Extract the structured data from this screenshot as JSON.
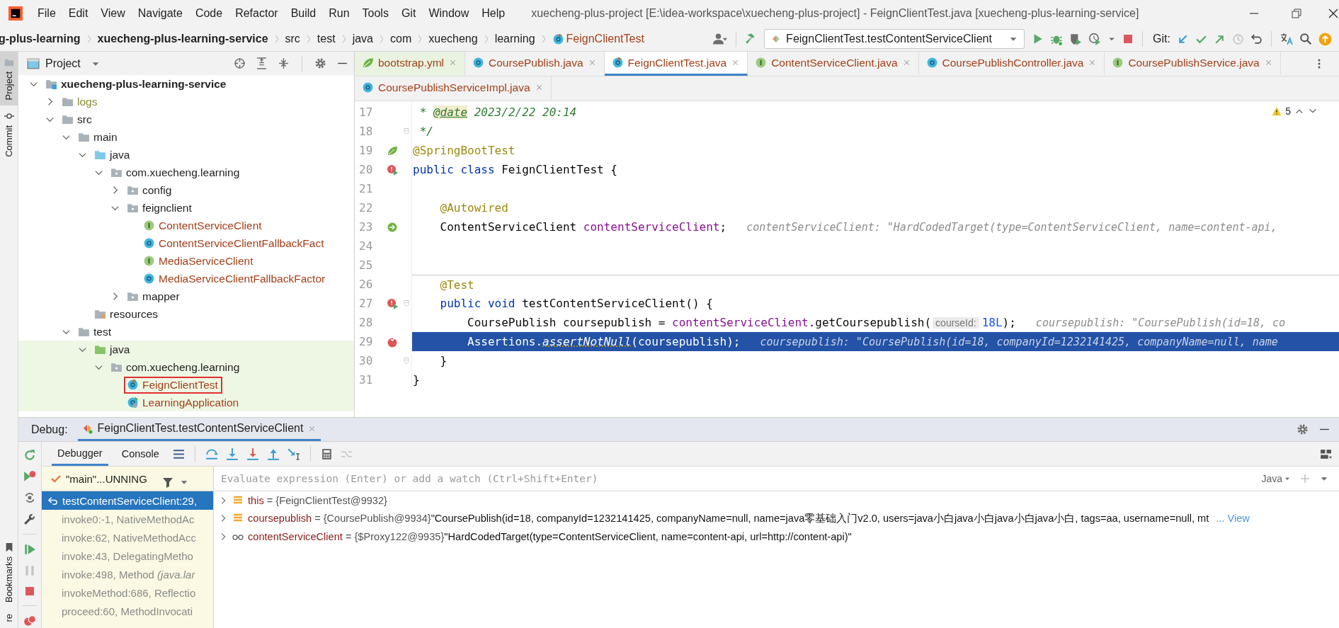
{
  "window": {
    "title": "xuecheng-plus-project [E:\\idea-workspace\\xuecheng-plus-project] - FeignClientTest.java [xuecheng-plus-learning-service]"
  },
  "menu": [
    "File",
    "Edit",
    "View",
    "Navigate",
    "Code",
    "Refactor",
    "Build",
    "Run",
    "Tools",
    "Git",
    "Window",
    "Help"
  ],
  "breadcrumb": [
    {
      "label": "g-plus-learning",
      "kind": "module"
    },
    {
      "label": "xuecheng-plus-learning-service",
      "kind": "module"
    },
    {
      "label": "src",
      "kind": "folder"
    },
    {
      "label": "test",
      "kind": "folder"
    },
    {
      "label": "java",
      "kind": "folder"
    },
    {
      "label": "com",
      "kind": "folder"
    },
    {
      "label": "xuecheng",
      "kind": "folder"
    },
    {
      "label": "learning",
      "kind": "folder"
    },
    {
      "label": "FeignClientTest",
      "kind": "test-class"
    }
  ],
  "run_config": {
    "label": "FeignClientTest.testContentServiceClient"
  },
  "git_label": "Git:",
  "tool_stripe": [
    {
      "label": "Project",
      "kind": "project",
      "selected": true
    },
    {
      "label": "Commit",
      "kind": "commit",
      "selected": false
    }
  ],
  "tool_stripe_bottom": [
    {
      "label": "Bookmarks",
      "kind": "bookmarks",
      "selected": false
    },
    {
      "label": "re",
      "selected": false
    }
  ],
  "project_panel": {
    "title": "Project"
  },
  "tree": [
    {
      "label": "xuecheng-plus-learning-service",
      "kind": "module",
      "expanded": true,
      "children": [
        {
          "label": "logs",
          "kind": "folder",
          "color": "#8a8a2e",
          "expanded": false
        },
        {
          "label": "src",
          "kind": "folder",
          "expanded": true,
          "children": [
            {
              "label": "main",
              "kind": "folder",
              "expanded": true,
              "children": [
                {
                  "label": "java",
                  "kind": "source-folder",
                  "expanded": true,
                  "children": [
                    {
                      "label": "com.xuecheng.learning",
                      "kind": "package",
                      "expanded": true,
                      "children": [
                        {
                          "label": "config",
                          "kind": "package",
                          "expanded": false
                        },
                        {
                          "label": "feignclient",
                          "kind": "package",
                          "expanded": true,
                          "children": [
                            {
                              "label": "ContentServiceClient",
                              "kind": "interface",
                              "color": "#a3401a"
                            },
                            {
                              "label": "ContentServiceClientFallbackFact",
                              "kind": "class",
                              "color": "#a3401a"
                            },
                            {
                              "label": "MediaServiceClient",
                              "kind": "interface",
                              "color": "#a3401a"
                            },
                            {
                              "label": "MediaServiceClientFallbackFactor",
                              "kind": "class",
                              "color": "#a3401a"
                            }
                          ]
                        },
                        {
                          "label": "mapper",
                          "kind": "package",
                          "expanded": false
                        }
                      ]
                    }
                  ]
                },
                {
                  "label": "resources",
                  "kind": "resources"
                }
              ]
            },
            {
              "label": "test",
              "kind": "folder",
              "expanded": true,
              "children": [
                {
                  "label": "java",
                  "kind": "test-folder",
                  "expanded": true,
                  "children": [
                    {
                      "label": "com.xuecheng.learning",
                      "kind": "package",
                      "expanded": true,
                      "children": [
                        {
                          "label": "FeignClientTest",
                          "kind": "test-class",
                          "color": "#a3401a",
                          "boxed": true
                        },
                        {
                          "label": "LearningApplication",
                          "kind": "app-class",
                          "color": "#a3401a"
                        }
                      ]
                    }
                  ]
                }
              ]
            }
          ]
        }
      ]
    }
  ],
  "tab_rows": [
    {
      "tabs": [
        {
          "label": "bootstrap.yml",
          "kind": "yaml",
          "selected": false
        },
        {
          "label": "CoursePublish.java",
          "kind": "class",
          "selected": false
        },
        {
          "label": "FeignClientTest.java",
          "kind": "test-class",
          "selected": true
        },
        {
          "label": "ContentServiceClient.java",
          "kind": "interface",
          "selected": false
        },
        {
          "label": "CoursePublishController.java",
          "kind": "class",
          "selected": false
        },
        {
          "label": "CoursePublishService.java",
          "kind": "interface",
          "selected": false
        }
      ]
    },
    {
      "tabs": [
        {
          "label": "CoursePublishServiceImpl.java",
          "kind": "class",
          "selected": false
        }
      ]
    }
  ],
  "editor": {
    "warnings": "5",
    "lines": [
      {
        "number": "17",
        "fold": false,
        "separator": false,
        "current": false,
        "parts": [
          {
            "kind": "code",
            "tokens": [
              {
                "text": " * ",
                "kind": "comment"
              },
              {
                "text": "@date",
                "kind": "doc-tag"
              },
              {
                "text": " 2023/2/22 20:14",
                "kind": "comment"
              }
            ]
          }
        ]
      },
      {
        "number": "18",
        "fold": true,
        "separator": false,
        "current": false,
        "parts": [
          {
            "kind": "code",
            "tokens": [
              {
                "text": " */",
                "kind": "comment"
              }
            ]
          }
        ]
      },
      {
        "number": "19",
        "gutter": {
          "kind": "spring"
        },
        "fold": false,
        "separator": false,
        "current": false,
        "parts": [
          {
            "kind": "code",
            "tokens": [
              {
                "text": "@SpringBootTest",
                "kind": "annotation"
              }
            ]
          }
        ]
      },
      {
        "number": "20",
        "gutter": {
          "kind": "run-breakpoint"
        },
        "fold": false,
        "separator": false,
        "current": false,
        "parts": [
          {
            "kind": "code",
            "tokens": [
              {
                "text": "public class ",
                "kind": "keyword"
              },
              {
                "text": "FeignClientTest {",
                "kind": "plain"
              }
            ]
          }
        ]
      },
      {
        "number": "21",
        "fold": false,
        "separator": false,
        "current": false
      },
      {
        "number": "22",
        "fold": false,
        "separator": false,
        "current": false,
        "parts": [
          {
            "kind": "code",
            "tokens": [
              {
                "text": "    @Autowired",
                "kind": "annotation"
              }
            ]
          }
        ]
      },
      {
        "number": "23",
        "gutter": {
          "kind": "bean"
        },
        "fold": false,
        "separator": false,
        "current": false,
        "parts": [
          {
            "kind": "code",
            "tokens": [
              {
                "text": "    ContentServiceClient ",
                "kind": "plain"
              },
              {
                "text": "contentServiceClient",
                "kind": "field"
              },
              {
                "text": ";",
                "kind": "plain"
              }
            ]
          },
          {
            "kind": "value",
            "text": "contentServiceClient: \"HardCodedTarget(type=ContentServiceClient, name=content-api,"
          }
        ]
      },
      {
        "number": "24",
        "fold": false,
        "separator": false,
        "current": false
      },
      {
        "number": "25",
        "fold": false,
        "separator": false,
        "current": false
      },
      {
        "number": "26",
        "fold": false,
        "separator": true,
        "current": false,
        "parts": [
          {
            "kind": "code",
            "tokens": [
              {
                "text": "    @Test",
                "kind": "annotation"
              }
            ]
          }
        ]
      },
      {
        "number": "27",
        "gutter": {
          "kind": "run-breakpoint"
        },
        "fold": true,
        "separator": false,
        "current": false,
        "parts": [
          {
            "kind": "code",
            "tokens": [
              {
                "text": "    public void ",
                "kind": "keyword"
              },
              {
                "text": "testContentServiceClient() {",
                "kind": "plain"
              }
            ]
          }
        ]
      },
      {
        "number": "28",
        "fold": false,
        "separator": false,
        "current": false,
        "parts": [
          {
            "kind": "code",
            "tokens": [
              {
                "text": "        CoursePublish coursepublish = ",
                "kind": "plain"
              },
              {
                "text": "contentServiceClient",
                "kind": "field"
              },
              {
                "text": ".getCoursepublish(",
                "kind": "plain"
              }
            ]
          },
          {
            "kind": "hint",
            "text": "courseId:"
          },
          {
            "kind": "code",
            "tokens": [
              {
                "text": "18L",
                "kind": "number"
              },
              {
                "text": ");",
                "kind": "plain"
              }
            ]
          },
          {
            "kind": "value",
            "text": "coursepublish: \"CoursePublish(id=18, co"
          }
        ]
      },
      {
        "number": "29",
        "gutter": {
          "kind": "breakpoint-check"
        },
        "fold": false,
        "separator": false,
        "current": true,
        "parts": [
          {
            "kind": "code",
            "tokens": [
              {
                "text": "        Assertions.",
                "kind": "plain"
              },
              {
                "text": "assertNotNull",
                "kind": "static-method"
              },
              {
                "text": "(coursepublish);",
                "kind": "plain"
              }
            ]
          },
          {
            "kind": "value",
            "text": "coursepublish: \"CoursePublish(id=18, companyId=1232141425, companyName=null, name"
          }
        ]
      },
      {
        "number": "30",
        "fold": true,
        "separator": false,
        "current": false,
        "parts": [
          {
            "kind": "code",
            "tokens": [
              {
                "text": "    }",
                "kind": "plain"
              }
            ]
          }
        ]
      },
      {
        "number": "31",
        "fold": false,
        "separator": false,
        "current": false,
        "parts": [
          {
            "kind": "code",
            "tokens": [
              {
                "text": "}",
                "kind": "plain"
              }
            ]
          }
        ]
      }
    ]
  },
  "debug": {
    "label": "Debug:",
    "session": "FeignClientTest.testContentServiceClient",
    "subtabs": [
      {
        "label": "Debugger",
        "selected": true
      },
      {
        "label": "Console",
        "selected": false
      }
    ],
    "thread": "\"main\"...UNNING",
    "frames": [
      {
        "label": "testContentServiceClient:29,",
        "selected": true,
        "library": false
      },
      {
        "label": "invoke0:-1, NativeMethodAc",
        "selected": false,
        "library": true
      },
      {
        "label": "invoke:62, NativeMethodAcc",
        "selected": false,
        "library": true
      },
      {
        "label": "invoke:43, DelegatingMetho",
        "selected": false,
        "library": true
      },
      {
        "label": "invoke:498, Method *(java.lar*",
        "selected": false,
        "library": true
      },
      {
        "label": "invokeMethod:686, Reflectio",
        "selected": false,
        "library": true
      },
      {
        "label": "proceed:60, MethodInvocati",
        "selected": false,
        "library": true
      }
    ],
    "evaluate": {
      "placeholder": "Evaluate expression (Enter) or add a watch (Ctrl+Shift+Enter)"
    },
    "language": "Java",
    "variables": [
      {
        "kind": "field",
        "expanded": false,
        "name": "this",
        "ref": "= {FeignClientTest@9932}"
      },
      {
        "kind": "field",
        "expanded": false,
        "name": "coursepublish",
        "ref": "= {CoursePublish@9934}",
        "value": "\"CoursePublish(id=18, companyId=1232141425, companyName=null, name=java零基础入门v2.0, users=java小白java小白java小白java小白, tags=aa, username=null, mt",
        "link": "... View"
      },
      {
        "kind": "watch",
        "expanded": false,
        "name": "contentServiceClient",
        "ref": "= {$Proxy122@9935}",
        "value": "\"HardCodedTarget(type=ContentServiceClient, name=content-api, url=http://content-api)\""
      }
    ]
  }
}
